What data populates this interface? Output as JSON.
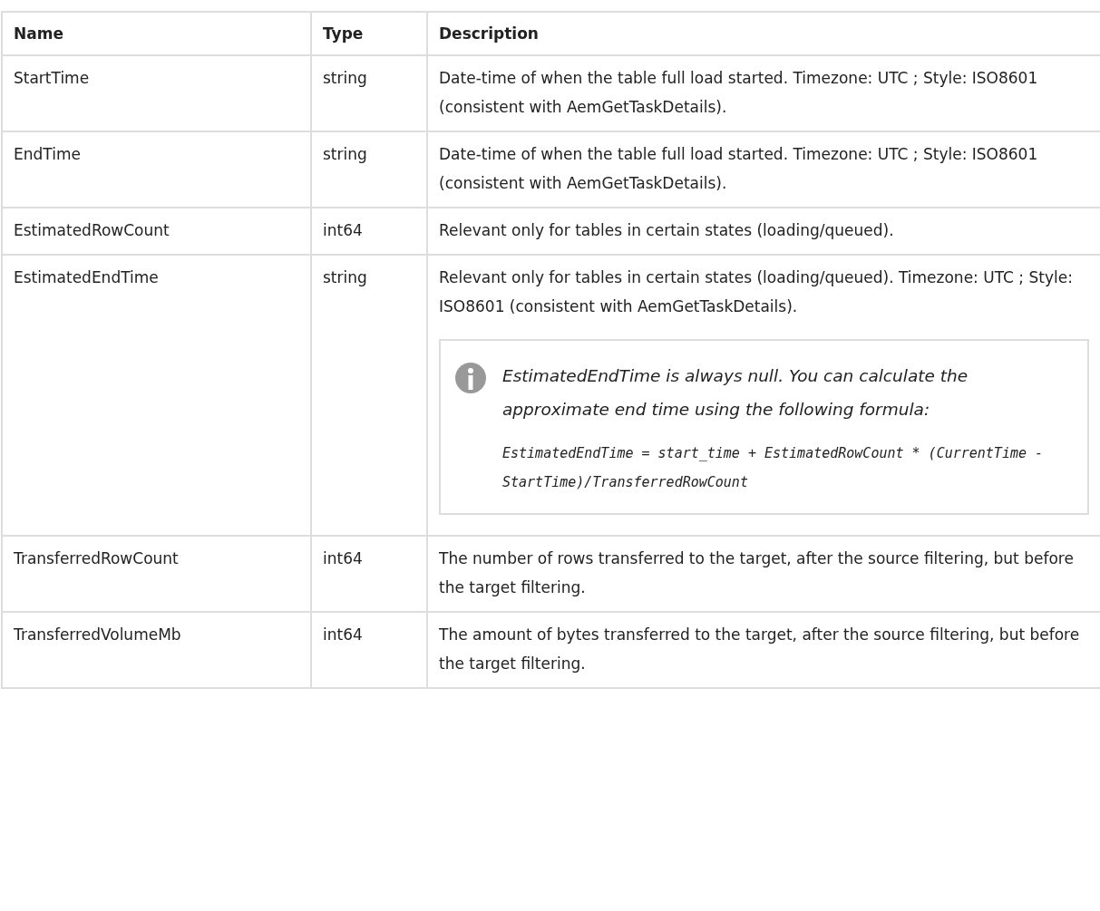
{
  "table": {
    "columns": [
      "Name",
      "Type",
      "Description"
    ],
    "rows": [
      {
        "name": "StartTime",
        "type": "string",
        "description": [
          "Date-time of when the table full load started. Timezone: UTC ; Style: ISO8601 (consistent with AemGetTaskDetails)."
        ]
      },
      {
        "name": "EndTime",
        "type": "string",
        "description": [
          "Date-time of when the table full load started. Timezone: UTC ; Style: ISO8601 (consistent with AemGetTaskDetails)."
        ]
      },
      {
        "name": "EstimatedRowCount",
        "type": "int64",
        "description": [
          "Relevant only for tables in certain states (loading/queued)."
        ]
      },
      {
        "name": "EstimatedEndTime",
        "type": "string",
        "description": [
          "Relevant only for tables in certain states (loading/queued). Timezone: UTC ; Style: ISO8601 (consistent with AemGetTaskDetails)."
        ],
        "note": {
          "text": "EstimatedEndTime is always null. You can calculate the approximate end time using the following formula:",
          "code": "EstimatedEndTime = start_time + EstimatedRowCount * (CurrentTime - StartTime)/TransferredRowCount"
        }
      },
      {
        "name": "TransferredRowCount",
        "type": "int64",
        "description": [
          "The number of rows transferred to the target, after the source filtering, but before the target filtering."
        ]
      },
      {
        "name": "TransferredVolumeMb",
        "type": "int64",
        "description": [
          "The amount of bytes transferred to the target, after the source filtering, but before the target filtering."
        ]
      }
    ]
  }
}
